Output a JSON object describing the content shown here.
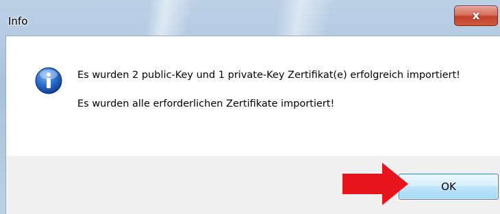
{
  "window": {
    "title": "Info",
    "close_glyph": "x"
  },
  "dialog": {
    "icon": "info-icon",
    "message_line1": "Es wurden 2 public-Key und 1 private-Key Zertifikat(e) erfolgreich importiert!",
    "message_line2": "Es wurden alle erforderlichen Zertifikate importiert!"
  },
  "buttons": {
    "ok_label": "OK"
  },
  "annotation": {
    "arrow_icon": "red-arrow-icon",
    "arrow_color": "#e8141b"
  },
  "colors": {
    "accent_blue": "#1c5fb4",
    "close_red": "#c3412a",
    "button_border": "#3c7fb1"
  }
}
